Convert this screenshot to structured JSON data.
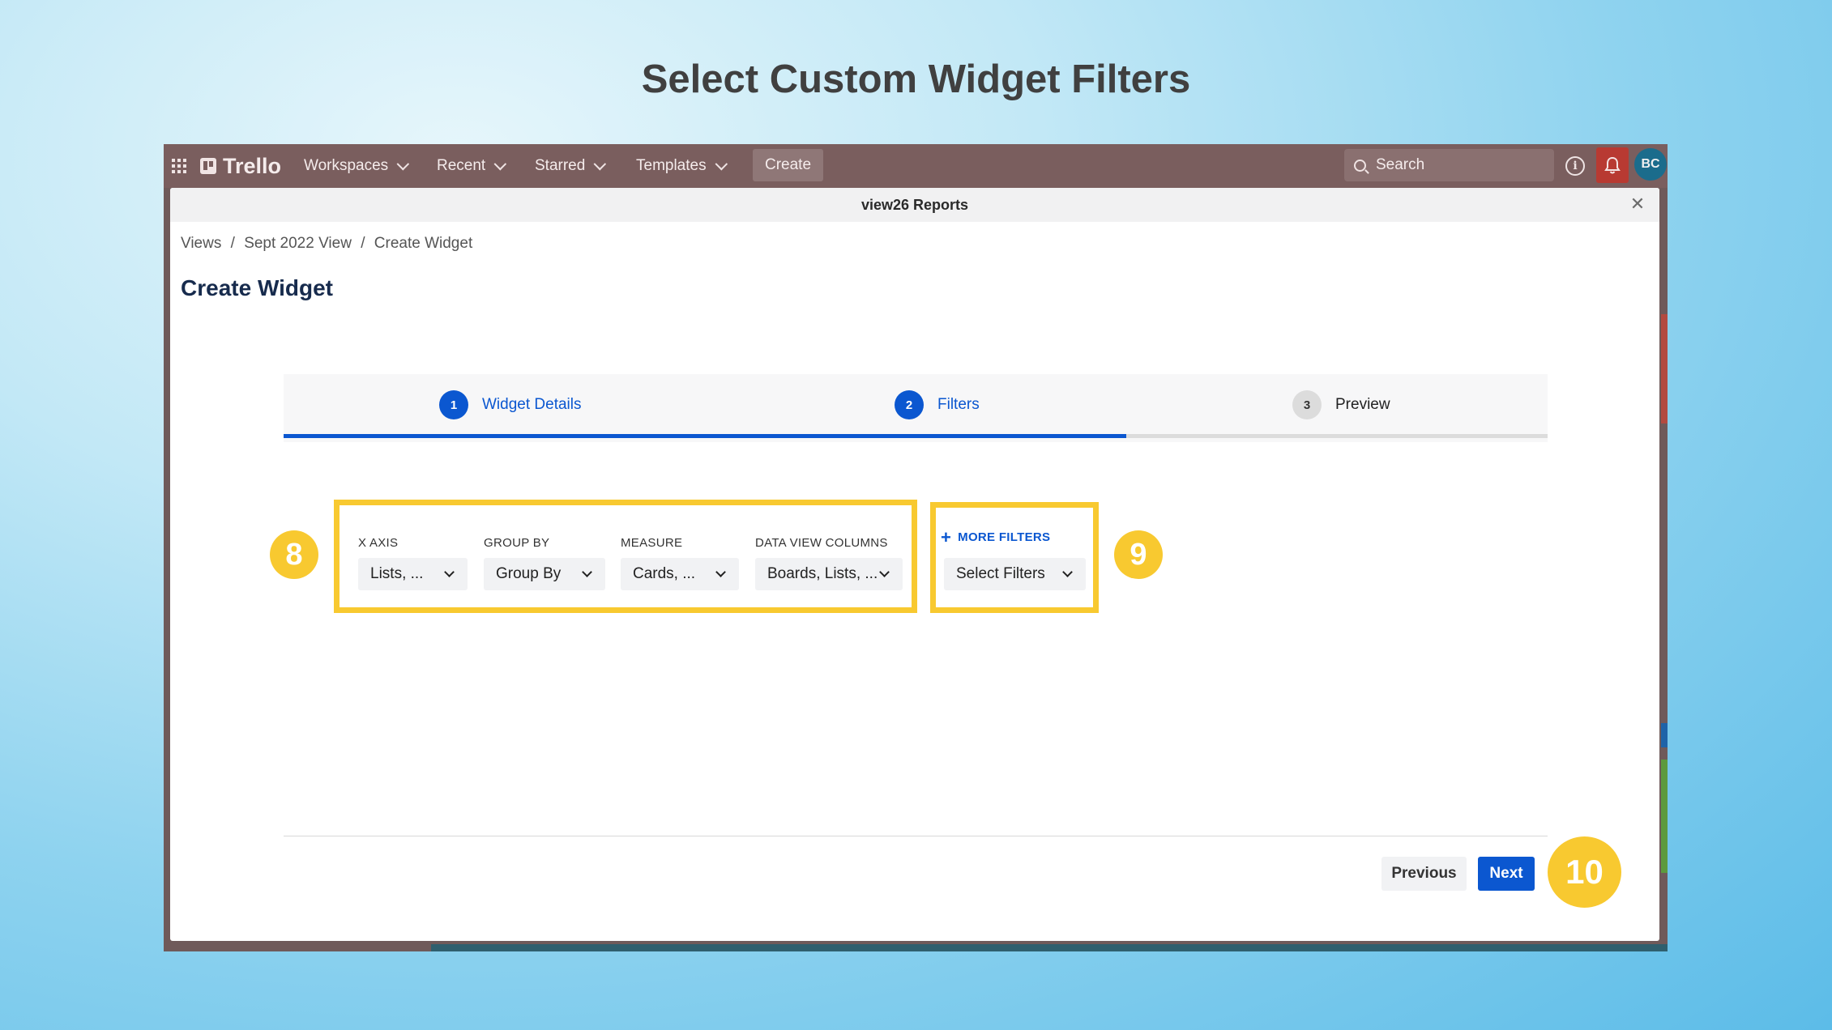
{
  "slide_title": "Select Custom Widget Filters",
  "topnav": {
    "logo": "Trello",
    "workspaces": "Workspaces",
    "recent": "Recent",
    "starred": "Starred",
    "templates": "Templates",
    "create": "Create",
    "search_placeholder": "Search",
    "avatar_initials": "BC"
  },
  "modal": {
    "header_title": "view26 Reports",
    "breadcrumb": [
      "Views",
      "/",
      "Sept 2022 View",
      "/",
      "Create Widget"
    ],
    "page_title": "Create Widget",
    "steps": [
      {
        "num": "1",
        "label": "Widget Details",
        "state": "complete"
      },
      {
        "num": "2",
        "label": "Filters",
        "state": "active"
      },
      {
        "num": "3",
        "label": "Preview",
        "state": "pending"
      }
    ],
    "step_progress": 0.6667,
    "filters": {
      "x_axis": {
        "label": "X AXIS",
        "value": "Lists, ..."
      },
      "group_by": {
        "label": "GROUP BY",
        "value": "Group By"
      },
      "measure": {
        "label": "MEASURE",
        "value": "Cards, ..."
      },
      "data_view_columns": {
        "label": "DATA VIEW COLUMNS",
        "value": "Boards, Lists, ..."
      }
    },
    "more_filters": {
      "label": "MORE FILTERS",
      "select_value": "Select Filters"
    },
    "buttons": {
      "previous": "Previous",
      "next": "Next"
    }
  },
  "annotations": {
    "badge_8": "8",
    "badge_9": "9",
    "badge_10": "10",
    "highlight_color": "#f8c930"
  },
  "colors": {
    "primary": "#0b57d0",
    "nav_bg": "#7a5e5e",
    "notification": "#b83a32"
  }
}
